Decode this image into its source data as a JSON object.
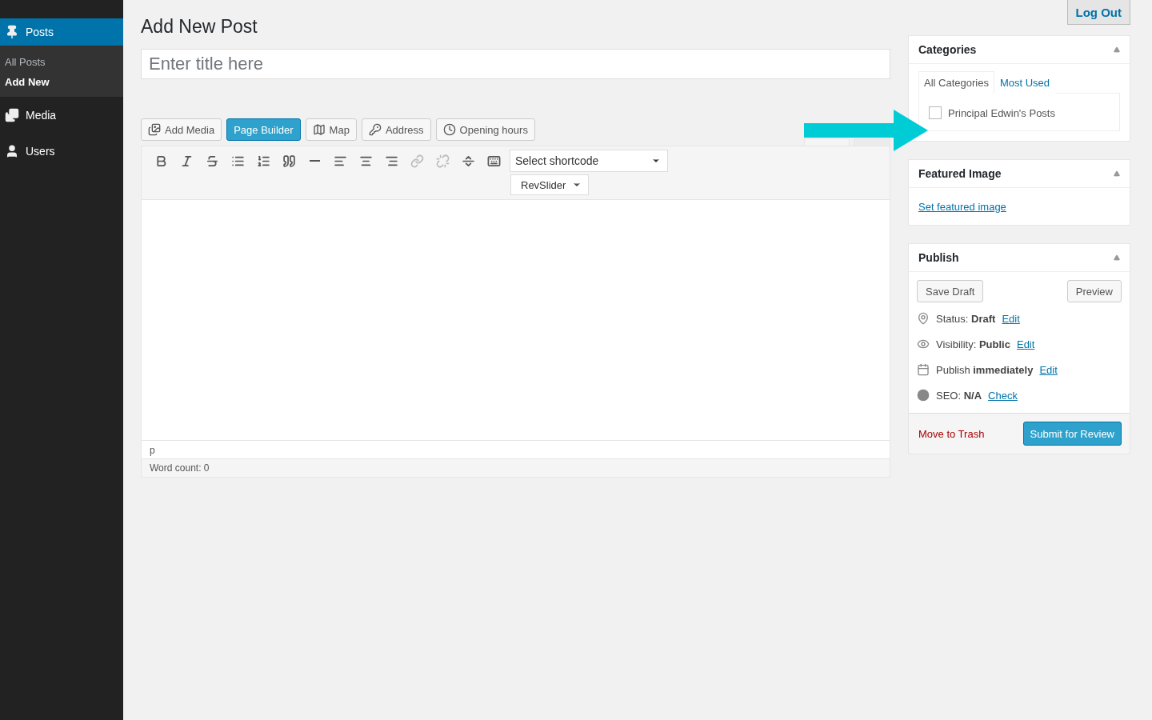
{
  "sidebar": {
    "items": [
      {
        "label": "Posts",
        "selected": true,
        "children": [
          {
            "label": "All Posts",
            "selected": false
          },
          {
            "label": "Add New",
            "selected": true
          }
        ]
      },
      {
        "label": "Media",
        "selected": false
      },
      {
        "label": "Users",
        "selected": false
      }
    ]
  },
  "header": {
    "title": "Add New Post",
    "logout": "Log Out"
  },
  "title_field": {
    "placeholder": "Enter title here"
  },
  "media_buttons": [
    {
      "label": "Add Media",
      "active": false
    },
    {
      "label": "Page Builder",
      "active": true
    },
    {
      "label": "Map",
      "active": false
    },
    {
      "label": "Address",
      "active": false
    },
    {
      "label": "Opening hours",
      "active": false
    }
  ],
  "toolbar": {
    "buttons": [
      {
        "disabled": false
      },
      {
        "disabled": false
      },
      {
        "disabled": false
      },
      {
        "disabled": false
      },
      {
        "disabled": false
      },
      {
        "disabled": false
      },
      {
        "disabled": false
      },
      {
        "disabled": false
      },
      {
        "disabled": false
      },
      {
        "disabled": false
      },
      {
        "disabled": true
      },
      {
        "disabled": true
      },
      {
        "disabled": false
      },
      {
        "disabled": false
      }
    ],
    "shortcode_select": "Select shortcode",
    "revslider": "RevSlider"
  },
  "status_path": "p",
  "word_count": "Word count: 0",
  "categories": {
    "title": "Categories",
    "tabs": [
      {
        "label": "All Categories",
        "selected": true
      },
      {
        "label": "Most Used",
        "selected": false
      }
    ],
    "items": [
      {
        "label": "Principal Edwin's Posts",
        "checked": false
      }
    ]
  },
  "featured_image": {
    "title": "Featured Image",
    "link": "Set featured image"
  },
  "publish": {
    "title": "Publish",
    "save_draft": "Save Draft",
    "preview": "Preview",
    "rows": [
      {
        "text": "Status: **Draft**",
        "link": "Edit"
      },
      {
        "text": "Visibility: **Public**",
        "link": "Edit"
      },
      {
        "text": "Publish **immediately**",
        "link": "Edit"
      },
      {
        "text": "SEO: **N/A**",
        "link": "Check"
      }
    ],
    "trash": "Move to Trash",
    "submit": "Submit for Review"
  }
}
